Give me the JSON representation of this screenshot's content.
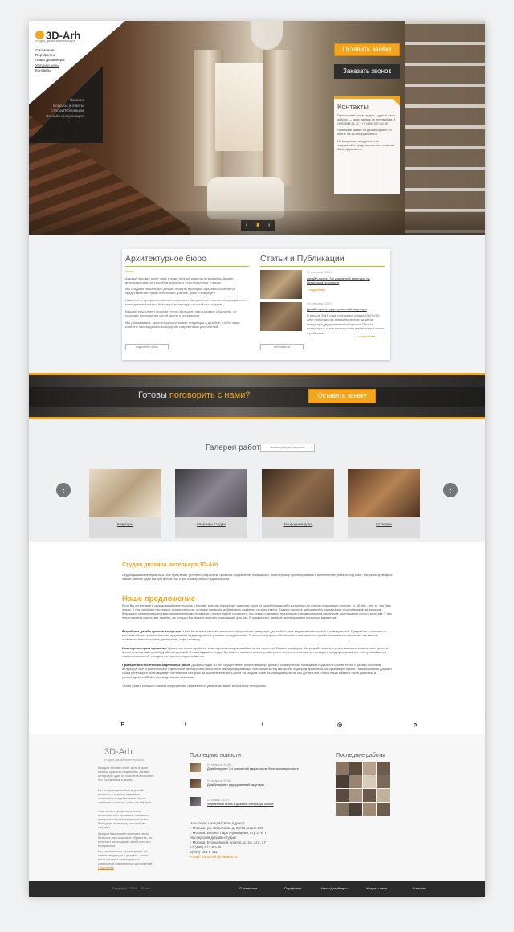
{
  "brand": {
    "logo_text": "3D-Arh",
    "logo_sub": "студия дизайна интерьера"
  },
  "top_menu": [
    "О компании",
    "Портфолио",
    "Наши Дизайнеры",
    "Услуги и цены",
    "Контакты"
  ],
  "dark_menu": [
    "Новости",
    "Вопросы и ответы",
    "Статьи/Публикации",
    "Он-лайн консультация"
  ],
  "hero": {
    "btn_request": "Оставить заявку",
    "btn_call": "Заказать звонок",
    "contacts_title": "Контакты",
    "contacts_p1": "Приглашаем вас в студию. Адрес и часы работы — ниже, запись по телефонам: 8 (495) 988-91-11 · +7 (495) 517-60-35",
    "contacts_p2": "Напишите заявку на дизайн-проект по почте: sa-3d-arh@yandex.ru",
    "contacts_p3": "По вопросам сотрудничества направляйте предложения на e-mail: sa-3d-arh@yandex.ru"
  },
  "about": {
    "title": "Архитектурное бюро",
    "link": "О нас",
    "p1": "Каждый человек хочет жить в доме полный красоты и гармонии. Дизайн интерьера один из способов воплотить это стремление в жизнь.",
    "p2": "Мы создаем уникальные дизайн-проекты в которых идеально сочетается представление наших клиентов о красоте, уюте и комфорте.",
    "p3": "Наш опыт и профессионализм позволяет нам проявлять элементы прекрасного в повседневной жизни, благодаря интерьеру, который мы создаем.",
    "p4": "Каждый наш клиент получает нечто большее, чем красивое убранство, он получает воплощение своей мечты о прекрасном.",
    "p5": "Мы развиваемся, ориентируясь на новые тенденции в дизайне, чтобы наши клиенты наслаждались комфортом современных достижений.",
    "btn": "подробнее о нас"
  },
  "news": {
    "title": "Статьи и Публикации",
    "items": [
      {
        "date": "24 февраля 2016 г.",
        "title": "Дизайн-проект 3-х комнатной квартиры на Ленинском проспекте",
        "more": "» подробнее"
      },
      {
        "date": "04 февраля 2016 г.",
        "title": "Дизайн-проект двухуровневой квартиры",
        "text": "В начале 2016 года портфолио студии ООО «3D-Arh» пополнилось новым проектом дизайна интерьера двухуровневой квартиры. Проект интерьера в стиле неоклассики для молодой семьи с ребенком",
        "more": "» подробнее"
      }
    ],
    "btn": "все новости"
  },
  "cta": {
    "text_lead": "Готовы ",
    "text_accent": "поговорить с нами?",
    "btn": "Оставить заявку"
  },
  "gallery": {
    "title": "Галерея работ",
    "btn": "посмотреть портфолио",
    "items": [
      "Квартиры",
      "Квартиры студии",
      "Загородные дома",
      "Коттеджи"
    ],
    "prev": "‹",
    "next": "›"
  },
  "article": {
    "h1": "Студия дизайна интерьера 3D-Arh",
    "intro": "Студия дизайна интерьера 3D-Arh предлагает услуги по разработке проектов оформления помещений, инженерному проектированию и выполнению ремонта под ключ. Мы реализуем даже самые смелые идеи как для жилой, так и для коммерческой недвижимости.",
    "h2": "Наше предложение",
    "p1": "Если Вы хотите найти студию дизайна интерьера в Москве, которая предлагает комплекс услуг от разработки дизайн-концепции до полной реализации проекта, то 3D-Arh – это то, что Вам нужно. У нас работают настоящие профессионалы, которые привыкли действовать слаженно на всех этапах. Также у нас есть широкая сеть подрядчиков и поставщиков материалов. Благодаря этим преимуществам наши клиенты могут заказать проект любой сложности. Мы всегда стараемся предложить нашим клиентам наилучшее соотношение цены и качества. У нас представлены различные тарифы, на которых Вы можете выбрать подходящий для Вас. В рамках этих тарифов мы предлагаем несколько вариантов.",
    "p2_b": "Разработка дизайн-проекта интерьера.",
    "p2": " У нас Вы можете заказать проект по оформлению интерьера для любого типа недвижимости: жилой и коммерческой. При работе с офисами и местами общего пользования мы предлагаем индивидуальные условия сотрудничества. В нашем портфолио Вы можете ознакомиться с уже выполненными проектами магазинов, стоматологических клиник, ресторанов, кафе гостиниц.",
    "p3_b": "Инженерное проектирование.",
    "p3": " Грамотное проектирование инженерных коммуникаций является гарантией Вашего комфорта. Мы разрабатываем и реализовываем инженерные проекты жилых помещений со свободной планировкой. В нашей дизайн-студии Вы можете заказать инженерный проект систем отопления, вентиляции и кондиционирования, электроснабжения, слаботочных сетей, холодного и горячего водоснабжения.",
    "p4_b": "Проведение строительно-отделочных работ.",
    "p4": " Дизайн-студия 3D-Arh осуществляет ремонт квартир, домов и коммерческих помещений под ключ в соответствии с дизайн-проектом интерьера. Все строительные и отделочные мероприятия выполняют квалифицированные специалисты под авторским надзором дизайнера, который ведет проект. Наша компания дорожит своей репутацией, поэтому ведет постоянный контроль за выполнением всех работ на каждом этапе реализации проекта. Мы делаем всё, чтобы наши клиенты были довольны и рекомендовали 3D-Arh своим друзьям и знакомым.",
    "p5": "Чтобы узнать больше о нашем предложении, позвоните по указанным выше контактным телефонам."
  },
  "social": [
    "B",
    "f",
    "t",
    "◎",
    "p"
  ],
  "footer": {
    "logo": "3D-Arh",
    "logo_sub": "студия дизайна интерьера",
    "p1": "Каждый человек хочет жить в доме полный красоты и гармонии. Дизайн интерьера один из способов воплотить это стремление в жизнь.",
    "p2": "Мы создаем уникальные дизайн-проекты, в которых идеально сочетается представление наших клиентов о красоте, уюте и комфорте.",
    "p3": "Наш опыт и профессионализм позволяет нам проявлять элементы прекрасного в повседневной жизни, благодаря интерьеру, который мы создаем.",
    "p4": "Каждый наш клиент получает нечто большее, чем красивое убранство, он получает воплощение своей мечты о прекрасном.",
    "p5": "Мы развиваемся, ориентируясь на новые тенденции в дизайне, чтобы наши клиенты наслаждались комфортом современных достижений.",
    "p5_link": "Подробнее",
    "news_title": "Последние новости",
    "news": [
      {
        "date": "24 февраля 2016 г.",
        "title": "Дизайн-проект 3-х комнатной квартиры на Ленинском проспекте"
      },
      {
        "date": "04 февраля 2016 г.",
        "title": "Дизайн-проект двухуровневой квартиры"
      },
      {
        "date": "21 января 2016 г.",
        "title": "Фирменный стиль в дизайне интерьера офиса"
      }
    ],
    "works_title": "Последние работы",
    "addr_title": "Наш офис находится по адресу:",
    "addr1": "г. Москва, ул. Вавилова, д. 69/75, офис 820",
    "addr2": "г. Москва, Бизнес парк Румянцево, стр 2, к. 7",
    "addr3": "Мастерская дизайн-студии:",
    "addr4": "г. Москва, Егорьевский проезд, д. 2А, стр. 27",
    "phone1": "+7 (495) 517-60-35",
    "phone2": "8(909) 660-8-111",
    "email": "e-mail: sa-3d-arh@yandex.ru",
    "copyright": "Copyright © 2016 - 3D-arh",
    "nav": [
      "О компании",
      "Портфолио",
      "Наши Дизайнеры",
      "Услуги и цены",
      "Контакты"
    ]
  },
  "colors": {
    "accent": "#f3a51c",
    "dark": "#2b2b2b"
  }
}
